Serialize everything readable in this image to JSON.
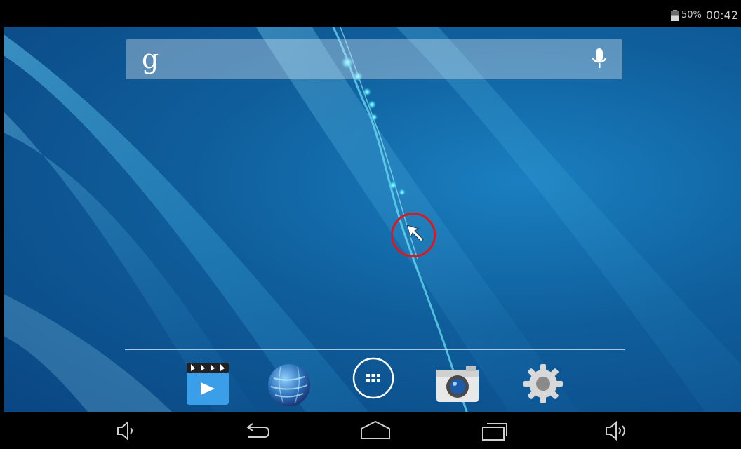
{
  "status_bar": {
    "battery_text": "50%",
    "clock": "00:42",
    "icons": [
      "battery-icon"
    ]
  },
  "search": {
    "logo": "g",
    "icons": [
      "google-search-icon",
      "microphone-icon"
    ]
  },
  "dock": {
    "apps": [
      "video-player-icon",
      "browser-globe-icon",
      "app-drawer-icon",
      "camera-icon",
      "settings-gear-icon"
    ]
  },
  "nav_bar": {
    "buttons": [
      "volume-down-icon",
      "back-icon",
      "home-icon",
      "recent-apps-icon",
      "volume-up-icon"
    ]
  },
  "colors": {
    "wallpaper_base": "#0f5e9b",
    "accent_cyan": "#3fd8f0",
    "highlight_ring": "#e0161c"
  }
}
